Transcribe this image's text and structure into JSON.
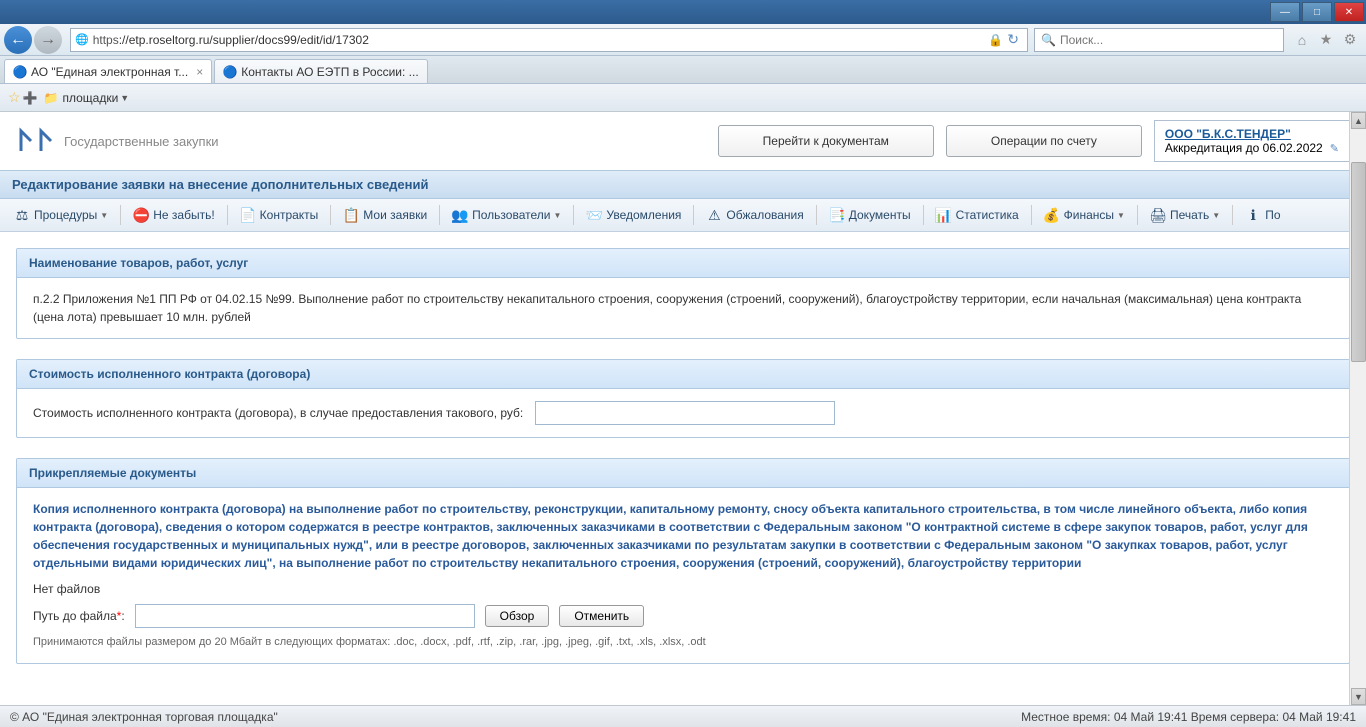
{
  "browser": {
    "url_protocol": "https",
    "url_rest": "://etp.roseltorg.ru/supplier/docs99/edit/id/17302",
    "search_placeholder": "Поиск...",
    "tab1": "АО \"Единая электронная т...",
    "tab2": "Контакты АО ЕЭТП в России: ...",
    "bookmark_folder": "площадки"
  },
  "header": {
    "logo_sub": "Государственные закупки",
    "btn_docs": "Перейти к документам",
    "btn_ops": "Операции по счету",
    "company": "ООО \"Б.К.С.ТЕНДЕР\"",
    "accreditation": "Аккредитация до 06.02.2022"
  },
  "page_title": "Редактирование заявки на внесение дополнительных сведений",
  "toolbar": {
    "procedures": "Процедуры",
    "remember": "Не забыть!",
    "contracts": "Контракты",
    "my_requests": "Мои заявки",
    "users": "Пользователи",
    "notifications": "Уведомления",
    "appeals": "Обжалования",
    "documents": "Документы",
    "statistics": "Статистика",
    "finances": "Финансы",
    "print": "Печать",
    "more": "По"
  },
  "panel1": {
    "head": "Наименование товаров, работ, услуг",
    "body": "п.2.2 Приложения №1 ПП РФ от 04.02.15 №99. Выполнение работ по строительству некапитального строения, сооружения (строений, сооружений), благоустройству территории, если начальная (максимальная) цена контракта (цена лота) превышает 10 млн. рублей"
  },
  "panel2": {
    "head": "Стоимость исполненного контракта (договора)",
    "label": "Стоимость исполненного контракта (договора), в случае предоставления такового, руб:"
  },
  "panel3": {
    "head": "Прикрепляемые документы",
    "instructions": "Копия исполненного контракта (договора) на выполнение работ по строительству, реконструкции, капитальному ремонту, сносу объекта капитального строительства, в том числе линейного объекта, либо копия контракта (договора), сведения о котором содержатся в реестре контрактов, заключенных заказчиками в соответствии с Федеральным законом \"О контрактной системе в сфере закупок товаров, работ, услуг для обеспечения государственных и муниципальных нужд\", или в реестре договоров, заключенных заказчиками по результатам закупки в соответствии с Федеральным законом \"О закупках товаров, работ, услуг отдельными видами юридических лиц\", на выполнение работ по строительству некапитального строения, сооружения (строений, сооружений), благоустройству территории",
    "no_files": "Нет файлов",
    "path_label": "Путь до файла",
    "browse": "Обзор",
    "cancel": "Отменить",
    "note": "Принимаются файлы размером до 20 Мбайт в следующих форматах: .doc, .docx, .pdf, .rtf, .zip, .rar, .jpg, .jpeg, .gif, .txt, .xls, .xlsx, .odt"
  },
  "status": {
    "copyright": "© АО \"Единая электронная торговая площадка\"",
    "time": "Местное время: 04 Май 19:41 Время сервера: 04 Май 19:41"
  }
}
